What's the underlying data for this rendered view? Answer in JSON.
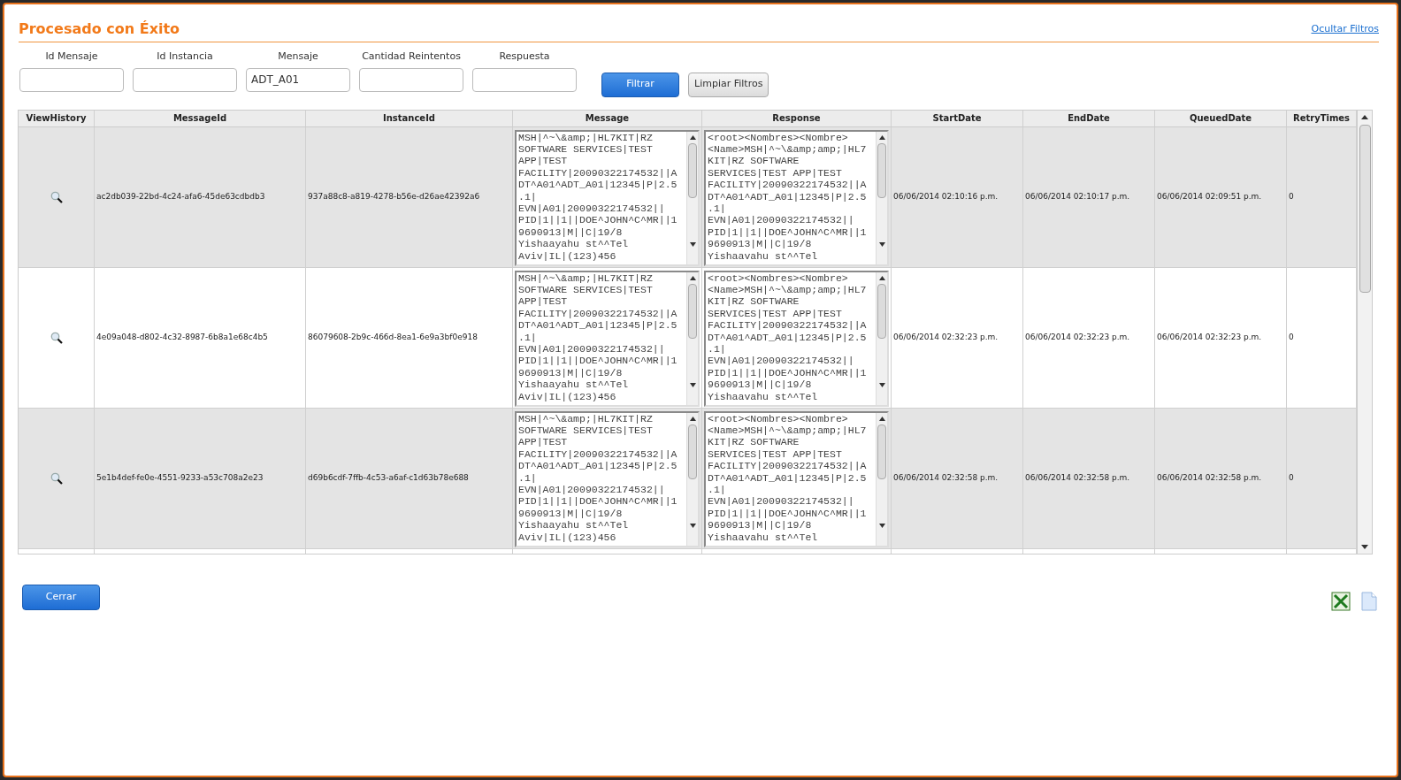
{
  "title": "Procesado con Éxito",
  "hide_filters_link": "Ocultar Filtros",
  "filters": [
    {
      "label": "Id Mensaje"
    },
    {
      "label": "Id Instancia"
    },
    {
      "label": "Mensaje",
      "value": "ADT_A01"
    },
    {
      "label": "Cantidad Reintentos"
    },
    {
      "label": "Respuesta"
    }
  ],
  "filter_buttons": [
    {
      "label": "Filtrar",
      "kind": "primary"
    },
    {
      "label": "Limpiar Filtros",
      "kind": "secondary"
    }
  ],
  "table": {
    "columns": [
      "ViewHistory",
      "MessageId",
      "InstanceId",
      "Message",
      "Response",
      "StartDate",
      "EndDate",
      "QueuedDate",
      "RetryTimes"
    ],
    "rows": [
      {
        "message_id": "ac2db039-22bd-4c24-afa6-45de63cdbdb3",
        "instance_id": "937a88c8-a819-4278-b56e-d26ae42392a6",
        "message": "MSH|^~\\&amp;|HL7KIT|RZ\nSOFTWARE SERVICES|TEST\nAPP|TEST\nFACILITY|20090322174532||A\nDT^A01^ADT_A01|12345|P|2.5\n.1|\nEVN|A01|20090322174532||\nPID|1||1||DOE^JOHN^C^MR||1\n9690913|M||C|19/8\nYishaayahu st^^Tel\nAviv|IL|(123)456",
        "response": "<root><Nombres><Nombre>\n<Name>MSH|^~\\&amp;amp;|HL7\nKIT|RZ SOFTWARE\nSERVICES|TEST APP|TEST\nFACILITY|20090322174532||A\nDT^A01^ADT_A01|12345|P|2.5\n.1|\nEVN|A01|20090322174532||\nPID|1||1||DOE^JOHN^C^MR||1\n9690913|M||C|19/8\nYishaavahu st^^Tel",
        "start": "06/06/2014 02:10:16 p.m.",
        "end": "06/06/2014 02:10:17 p.m.",
        "queued": "06/06/2014 02:09:51 p.m.",
        "retry": "0"
      },
      {
        "message_id": "4e09a048-d802-4c32-8987-6b8a1e68c4b5",
        "instance_id": "86079608-2b9c-466d-8ea1-6e9a3bf0e918",
        "message": "MSH|^~\\&amp;|HL7KIT|RZ\nSOFTWARE SERVICES|TEST\nAPP|TEST\nFACILITY|20090322174532||A\nDT^A01^ADT_A01|12345|P|2.5\n.1|\nEVN|A01|20090322174532||\nPID|1||1||DOE^JOHN^C^MR||1\n9690913|M||C|19/8\nYishaayahu st^^Tel\nAviv|IL|(123)456",
        "response": "<root><Nombres><Nombre>\n<Name>MSH|^~\\&amp;amp;|HL7\nKIT|RZ SOFTWARE\nSERVICES|TEST APP|TEST\nFACILITY|20090322174532||A\nDT^A01^ADT_A01|12345|P|2.5\n.1|\nEVN|A01|20090322174532||\nPID|1||1||DOE^JOHN^C^MR||1\n9690913|M||C|19/8\nYishaavahu st^^Tel",
        "start": "06/06/2014 02:32:23 p.m.",
        "end": "06/06/2014 02:32:23 p.m.",
        "queued": "06/06/2014 02:32:23 p.m.",
        "retry": "0"
      },
      {
        "message_id": "5e1b4def-fe0e-4551-9233-a53c708a2e23",
        "instance_id": "d69b6cdf-7ffb-4c53-a6af-c1d63b78e688",
        "message": "MSH|^~\\&amp;|HL7KIT|RZ\nSOFTWARE SERVICES|TEST\nAPP|TEST\nFACILITY|20090322174532||A\nDT^A01^ADT_A01|12345|P|2.5\n.1|\nEVN|A01|20090322174532||\nPID|1||1||DOE^JOHN^C^MR||1\n9690913|M||C|19/8\nYishaayahu st^^Tel\nAviv|IL|(123)456",
        "response": "<root><Nombres><Nombre>\n<Name>MSH|^~\\&amp;amp;|HL7\nKIT|RZ SOFTWARE\nSERVICES|TEST APP|TEST\nFACILITY|20090322174532||A\nDT^A01^ADT_A01|12345|P|2.5\n.1|\nEVN|A01|20090322174532||\nPID|1||1||DOE^JOHN^C^MR||1\n9690913|M||C|19/8\nYishaavahu st^^Tel",
        "start": "06/06/2014 02:32:58 p.m.",
        "end": "06/06/2014 02:32:58 p.m.",
        "queued": "06/06/2014 02:32:58 p.m.",
        "retry": "0"
      }
    ]
  },
  "close_button": "Cerrar"
}
